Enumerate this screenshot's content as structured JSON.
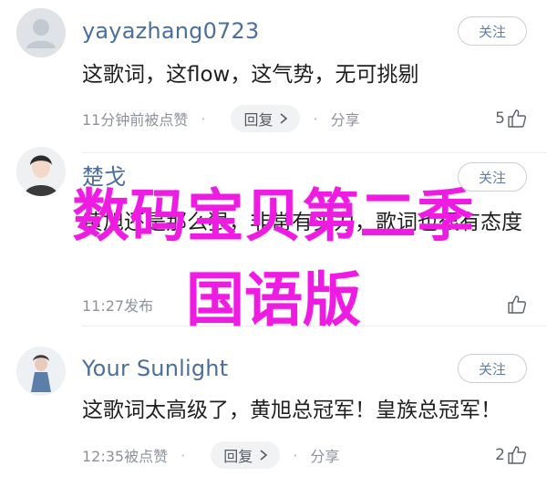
{
  "comments": [
    {
      "username": "yayazhang0723",
      "follow_label": "关注",
      "content": "这歌词，这flow，这气势，无可挑剔",
      "meta": "11分钟前被点赞",
      "reply_label": "回复",
      "share_label": "分享",
      "likes": "5"
    },
    {
      "username": "楚戈",
      "follow_label": "关注",
      "content": "黄旭还是那么狠，非常有实力，歌词也很有态度",
      "meta": "11:27发布",
      "reply_label": "",
      "share_label": "",
      "likes": ""
    },
    {
      "username": "Your Sunlight",
      "follow_label": "关注",
      "content": "这歌词太高级了，黄旭总冠军！皇族总冠军！",
      "meta": "12:35被点赞",
      "reply_label": "回复",
      "share_label": "分享",
      "likes": "2"
    }
  ],
  "overlay": {
    "line1": "数码宝贝第二季",
    "line2": "国语版",
    "color": "#ee1be3"
  },
  "colors": {
    "username": "#4a6f9c",
    "follow": "#5d7fa8",
    "meta": "#8d929a"
  },
  "icons": [
    "avatar-placeholder-icon",
    "chevron-right-icon",
    "thumbs-up-icon"
  ]
}
